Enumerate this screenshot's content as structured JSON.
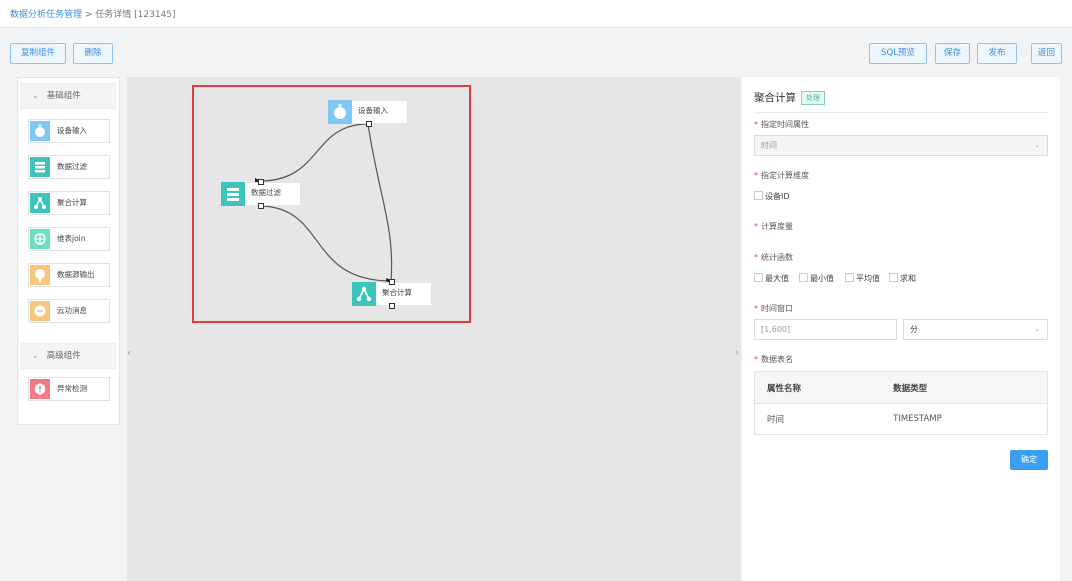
{
  "breadcrumb": {
    "parent": "数据分析任务管理",
    "separator": " > ",
    "current": "任务详情 [123145]"
  },
  "toolbar": {
    "copy_label": "复制组件",
    "delete_label": "删除",
    "sql_preview_label": "SQL预览",
    "save_label": "保存",
    "publish_label": "发布",
    "back_label": "返回"
  },
  "palette": {
    "basic_group": "基础组件",
    "advanced_group": "高级组件",
    "basic_items": [
      {
        "label": "设备输入",
        "icon": "stopwatch-icon",
        "color": "#7cc8f2"
      },
      {
        "label": "数据过滤",
        "icon": "filter-table-icon",
        "color": "#3cc4bd"
      },
      {
        "label": "聚合计算",
        "icon": "aggregate-icon",
        "color": "#3cc4bd"
      },
      {
        "label": "维表join",
        "icon": "join-icon",
        "color": "#6fdcc2"
      },
      {
        "label": "数据源输出",
        "icon": "output-icon",
        "color": "#f7c77f"
      },
      {
        "label": "云功消息",
        "icon": "message-icon",
        "color": "#f7c77f"
      }
    ],
    "advanced_items": [
      {
        "label": "异常检测",
        "icon": "anomaly-icon",
        "color": "#f07a86"
      }
    ]
  },
  "canvas": {
    "nodes": [
      {
        "label": "设备输入",
        "icon": "stopwatch-icon",
        "color": "#7cc8f2"
      },
      {
        "label": "数据过滤",
        "icon": "filter-table-icon",
        "color": "#3cc4bd"
      },
      {
        "label": "聚合计算",
        "icon": "aggregate-icon",
        "color": "#3cc4bd"
      }
    ]
  },
  "panel": {
    "title": "聚合计算",
    "tag": "处理",
    "time_attr_label": "指定时间属性",
    "time_attr_value": "时间",
    "dimension_label": "指定计算维度",
    "dimension_options": [
      "设备ID"
    ],
    "measure_label": "计算度量",
    "stat_label": "统计函数",
    "stat_options": [
      "最大值",
      "最小值",
      "平均值",
      "求和"
    ],
    "window_label": "时间窗口",
    "window_placeholder": "[1,600]",
    "window_unit": "分",
    "schema_label": "数据表名",
    "table": {
      "headers": [
        "属性名称",
        "数据类型"
      ],
      "rows": [
        [
          "时间",
          "TIMESTAMP"
        ]
      ]
    },
    "confirm_label": "确定"
  },
  "colors": {
    "accent": "#3a8ee6",
    "selection": "#e23c3c",
    "primary_button": "#3a9ef5"
  }
}
